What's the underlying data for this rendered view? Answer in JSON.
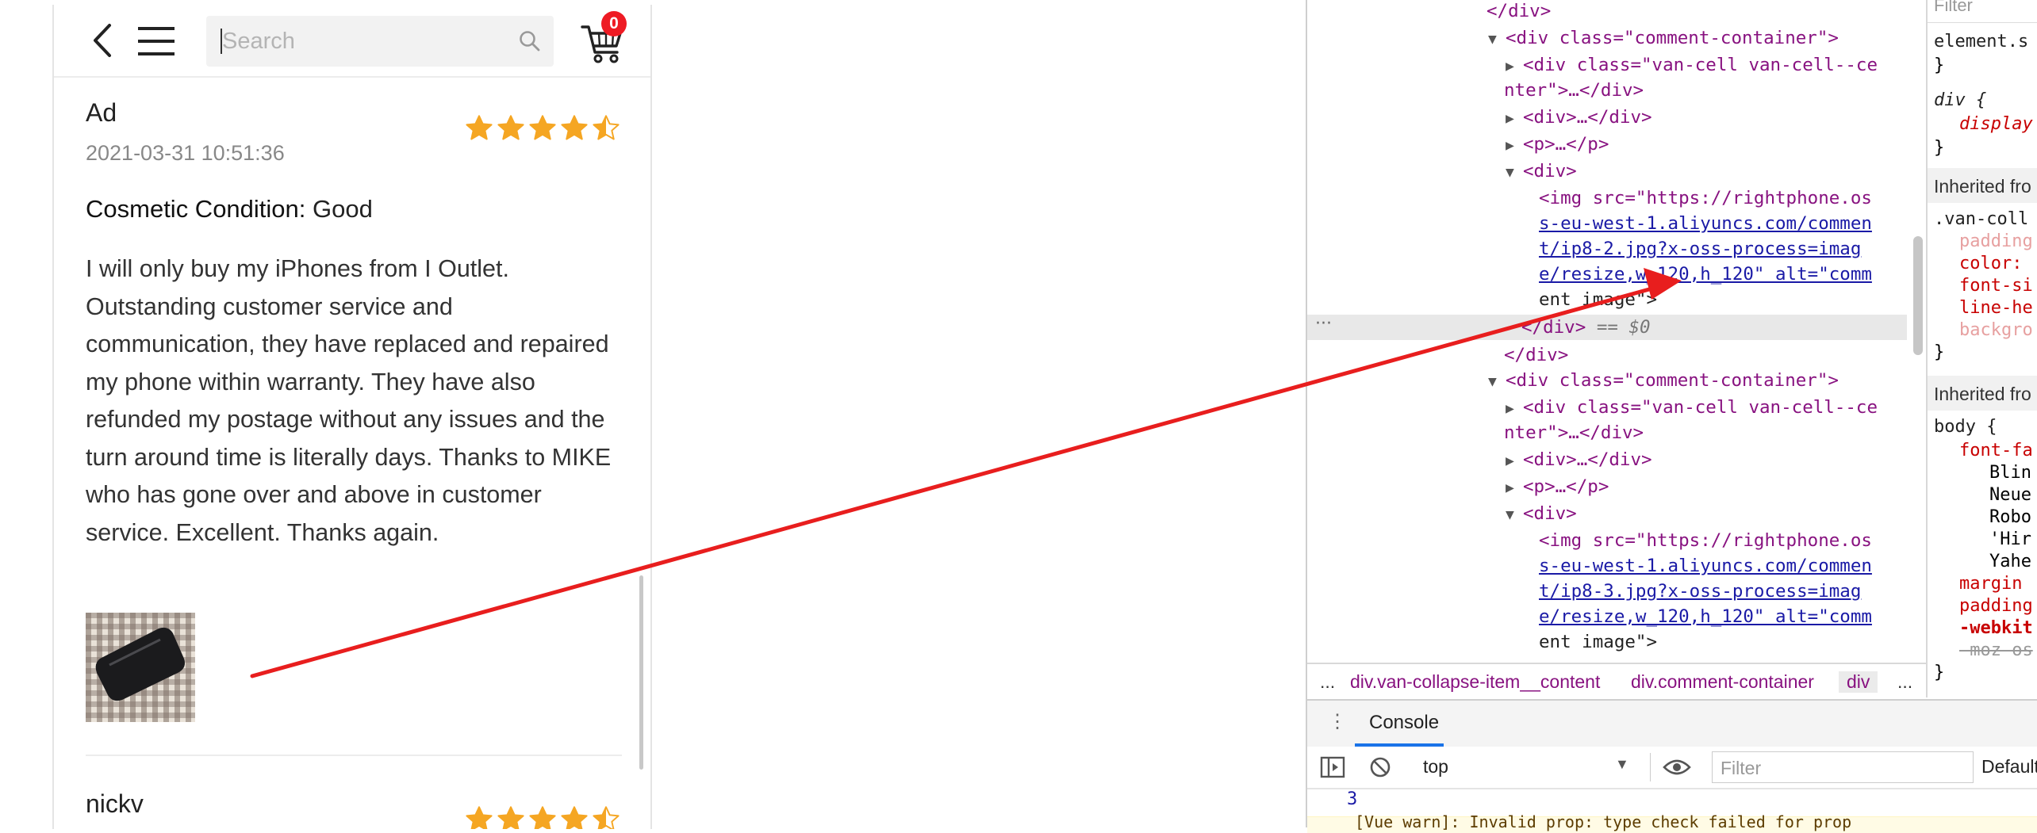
{
  "mobile": {
    "search_placeholder": "Search",
    "cart_count": "0",
    "reviews": [
      {
        "author": "Ad",
        "date": "2021-03-31 10:51:36",
        "rating": 4.5,
        "condition_label": "Cosmetic Condition:",
        "condition_value": "Good",
        "text": "I will only buy my iPhones from I Outlet. Outstanding customer service and communication, they have replaced and repaired my phone within warranty. They have also refunded my postage without any issues and the turn around time is literally days. Thanks to MIKE who has gone over and above in customer service. Excellent. Thanks again."
      },
      {
        "author": "nickv",
        "rating": 4.5
      }
    ]
  },
  "devtools": {
    "dom": {
      "close_div": "</div>",
      "comment_container_open": "<div class=\"comment-container\">",
      "cell_line1": "<div class=\"van-cell van-cell--ce",
      "cell_line2": "nter\">…</div>",
      "div_collapsed": "<div>…</div>",
      "p_collapsed": "<p>…</p>",
      "div_open": "<div>",
      "img1_lines": [
        "<img src=\"https://rightphone.os",
        "s-eu-west-1.aliyuncs.com/commen",
        "t/ip8-2.jpg?x-oss-process=imag",
        "e/resize,w_120,h_120\" alt=\"comm",
        "ent image\">"
      ],
      "selected_close": "</div>",
      "selected_marker": "== $0",
      "img2_lines": [
        "<img src=\"https://rightphone.os",
        "s-eu-west-1.aliyuncs.com/commen",
        "t/ip8-3.jpg?x-oss-process=imag",
        "e/resize,w_120,h_120\" alt=\"comm",
        "ent image\">"
      ]
    },
    "breadcrumbs": {
      "more_left": "...",
      "item1": "div.van-collapse-item__content",
      "item2": "div.comment-container",
      "item3": "div",
      "more_right": "..."
    },
    "styles": {
      "filter": "Filter",
      "element_style": "element.s",
      "close_brace": "}",
      "div_rule_selector": "div {",
      "div_rule_prop": "display",
      "inherited1": "Inherited fro",
      "van_selector": ".van-coll",
      "van_props": [
        "padding",
        "color:",
        "font-si",
        "line-he",
        "backgro"
      ],
      "inherited2": "Inherited fro",
      "body_selector": "body {",
      "body_font_prop": "font-fa",
      "body_font_values": [
        "Blin",
        "Neue",
        "Robo",
        "'Hir",
        "Yahe"
      ],
      "body_margin": "margin",
      "body_padding": "padding",
      "body_webkit": "-webkit",
      "body_moz": "-moz-os"
    },
    "console": {
      "tab": "Console",
      "context": "top",
      "filter_placeholder": "Filter",
      "levels": "Default",
      "output_value": "3",
      "warning_text": "[Vue warn]: Invalid prop: type check failed for prop"
    }
  },
  "colors": {
    "star": "#f5a623",
    "badge": "#ee1b24",
    "annotation_arrow": "#e81e1e",
    "devtools_tag": "#881280",
    "devtools_attr": "#994500",
    "devtools_value": "#1a1aa6"
  }
}
